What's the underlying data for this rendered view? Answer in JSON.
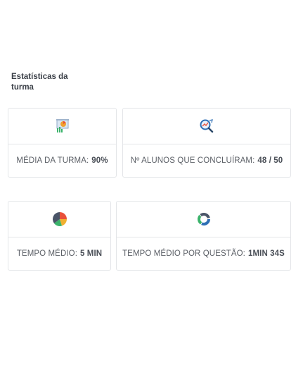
{
  "section": {
    "title": "Estatísticas da turma"
  },
  "stats": [
    {
      "label": "MÉDIA DA TURMA:",
      "value": "90%",
      "icon": "presentation-chart-icon"
    },
    {
      "label": "Nº ALUNOS QUE CONCLUÍRAM:",
      "value": "48 / 50",
      "icon": "magnifier-chart-icon"
    },
    {
      "label": "TEMPO MÉDIO:",
      "value": "5 MIN",
      "icon": "pie-chart-icon"
    },
    {
      "label": "TEMPO MÉDIO POR QUESTÃO:",
      "value": "1MIN 34S",
      "icon": "donut-chart-icon"
    }
  ],
  "colors": {
    "border": "#e3e5e8",
    "text": "#5b5f66",
    "value": "#4a4f57"
  }
}
